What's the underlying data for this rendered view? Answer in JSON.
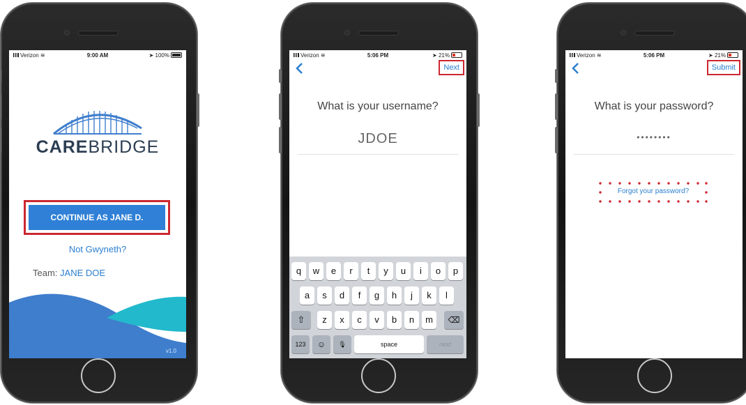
{
  "colors": {
    "accent": "#2f80d6",
    "highlight": "#cc2730",
    "brand_dark": "#2c3e52",
    "wave_blue": "#3f7ecd",
    "wave_teal": "#22b9cc"
  },
  "phone1": {
    "status": {
      "carrier": "Verizon",
      "time": "9:00 AM",
      "battery": "100%"
    },
    "brand_bold": "CARE",
    "brand_light": "BRIDGE",
    "continue_label": "CONTINUE AS JANE D.",
    "not_user_link": "Not Gwyneth?",
    "team_label": "Team:",
    "team_value": "JANE DOE",
    "version": "v1.0"
  },
  "phone2": {
    "status": {
      "carrier": "Verizon",
      "time": "5:06 PM",
      "battery": "21%"
    },
    "next_label": "Next",
    "question": "What is your username?",
    "username_value": "JDOE",
    "keyboard": {
      "row1": [
        "q",
        "w",
        "e",
        "r",
        "t",
        "y",
        "u",
        "i",
        "o",
        "p"
      ],
      "row2": [
        "a",
        "s",
        "d",
        "f",
        "g",
        "h",
        "j",
        "k",
        "l"
      ],
      "row3": [
        "z",
        "x",
        "c",
        "v",
        "b",
        "n",
        "m"
      ],
      "shift": "⇧",
      "delete": "⌫",
      "numbers": "123",
      "emoji": "☺",
      "mic": "🎙",
      "space": "space",
      "next": "next"
    }
  },
  "phone3": {
    "status": {
      "carrier": "Verizon",
      "time": "5:06 PM",
      "battery": "21%"
    },
    "submit_label": "Submit",
    "question": "What is your password?",
    "password_value": "••••••••",
    "forgot_link": "Forgot your password?"
  }
}
